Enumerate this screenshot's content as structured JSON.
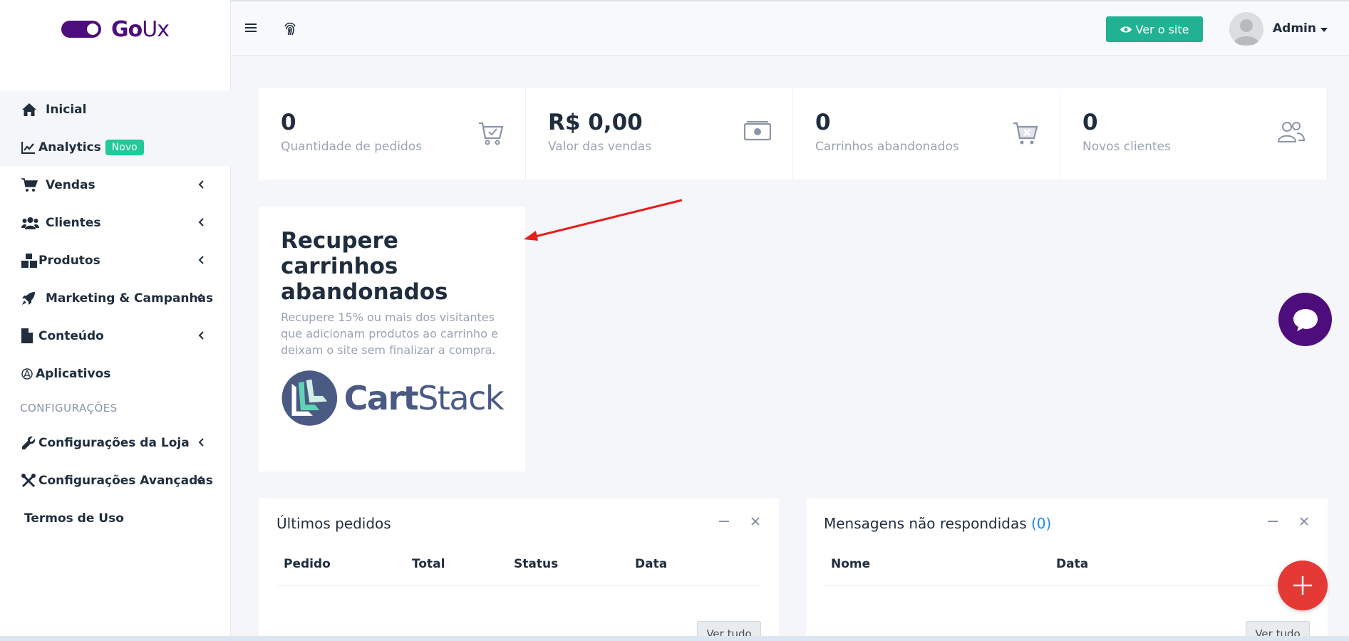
{
  "brand": {
    "go": "Go",
    "ux": "Ux"
  },
  "topbar": {
    "site_button": "Ver o site",
    "user": "Admin"
  },
  "sidebar": {
    "items": [
      {
        "label": "Inicial",
        "icon": "home-icon"
      },
      {
        "label": "Analytics",
        "badge": "Novo",
        "icon": "chart-line-icon"
      },
      {
        "label": "Vendas",
        "icon": "cart-icon"
      },
      {
        "label": "Clientes",
        "icon": "users-icon"
      },
      {
        "label": "Produtos",
        "icon": "boxes-icon"
      },
      {
        "label": "Marketing & Campanhas",
        "icon": "rocket-icon"
      },
      {
        "label": "Conteúdo",
        "icon": "file-icon"
      },
      {
        "label": "Aplicativos",
        "icon": "apps-icon"
      }
    ],
    "section_header": "CONFIGURAÇÕES",
    "config_items": [
      {
        "label": "Configurações da Loja",
        "icon": "wrench-icon"
      },
      {
        "label": "Configurações Avançadas",
        "icon": "tools-icon"
      },
      {
        "label": "Termos de Uso"
      }
    ]
  },
  "stats": [
    {
      "value": "0",
      "label": "Quantidade de pedidos",
      "icon": "cart-check-icon"
    },
    {
      "value": "R$ 0,00",
      "label": "Valor das vendas",
      "icon": "money-icon"
    },
    {
      "value": "0",
      "label": "Carrinhos abandonados",
      "icon": "cart-x-icon"
    },
    {
      "value": "0",
      "label": "Novos clientes",
      "icon": "people-icon"
    }
  ],
  "recover": {
    "title": "Recupere carrinhos abandonados",
    "description": "Recupere 15% ou mais dos visitantes que adicionam produtos ao carrinho e deixam o site sem finalizar a compra.",
    "logo_cart": "Cart",
    "logo_stack": "Stack"
  },
  "orders_panel": {
    "title": "Últimos pedidos",
    "columns": [
      "Pedido",
      "Total",
      "Status",
      "Data"
    ],
    "button": "Ver tudo"
  },
  "messages_panel": {
    "title": "Mensagens não respondidas",
    "count": "(0)",
    "columns": [
      "Nome",
      "Data"
    ],
    "button": "Ver tudo"
  },
  "colors": {
    "brand": "#4e0d7c",
    "accent": "#20b292",
    "fab": "#e53935"
  }
}
